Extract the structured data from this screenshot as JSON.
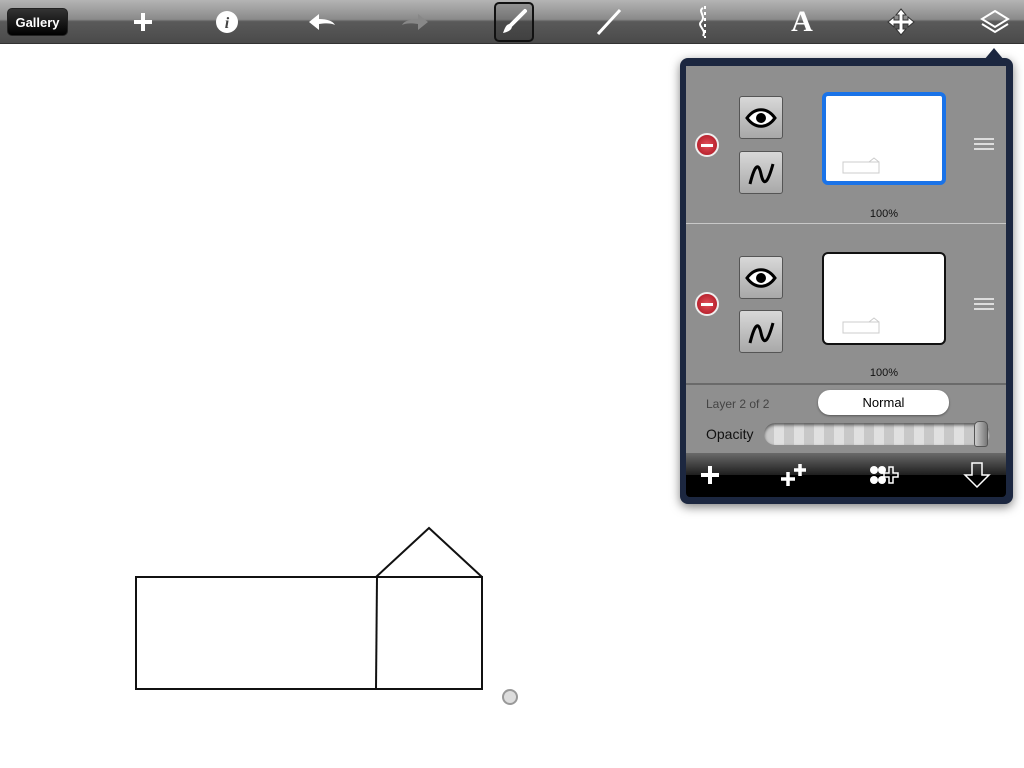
{
  "toolbar": {
    "gallery_label": "Gallery",
    "icons": [
      "plus-icon",
      "info-icon",
      "undo-icon",
      "redo-icon",
      "brush-icon",
      "line-icon",
      "symmetry-icon",
      "text-icon",
      "move-icon",
      "layers-icon"
    ],
    "selected_tool": "brush",
    "text_tool_label": "A"
  },
  "layers_panel": {
    "layers": [
      {
        "opacity": "100%",
        "selected": true,
        "visible": true
      },
      {
        "opacity": "100%",
        "selected": false,
        "visible": true
      }
    ],
    "layer_info": "Layer 2 of 2",
    "blend_mode": "Normal",
    "opacity_label": "Opacity",
    "opacity_value": 1.0,
    "bottom_icons": [
      "add-layer-icon",
      "duplicate-layer-icon",
      "merge-layer-icon",
      "merge-down-icon"
    ]
  },
  "colors": {
    "selected_layer_border": "#1a73e8",
    "delete": "#c0202a",
    "panel_frame": "#1c2740"
  }
}
